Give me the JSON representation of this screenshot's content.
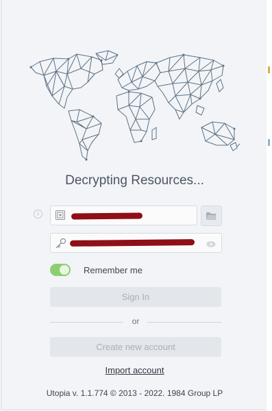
{
  "status_text": "Decrypting Resources...",
  "login": {
    "remember_label": "Remember me",
    "remember_on": true,
    "sign_in_label": "Sign In",
    "or_label": "or",
    "create_account_label": "Create new account",
    "import_account_label": "Import account"
  },
  "footer": {
    "version_text": "Utopia v. 1.1.774 © 2013 - 2022. 1984 Group LP"
  },
  "colors": {
    "background": "#f2f4f7",
    "toggle_on": "#8ccf73",
    "redaction": "#8e0f18",
    "map_stroke": "#5b6f84"
  },
  "icons": {
    "info": "info-icon",
    "storage": "storage-icon",
    "folder": "folder-icon",
    "key": "key-icon",
    "eye": "eye-icon"
  }
}
